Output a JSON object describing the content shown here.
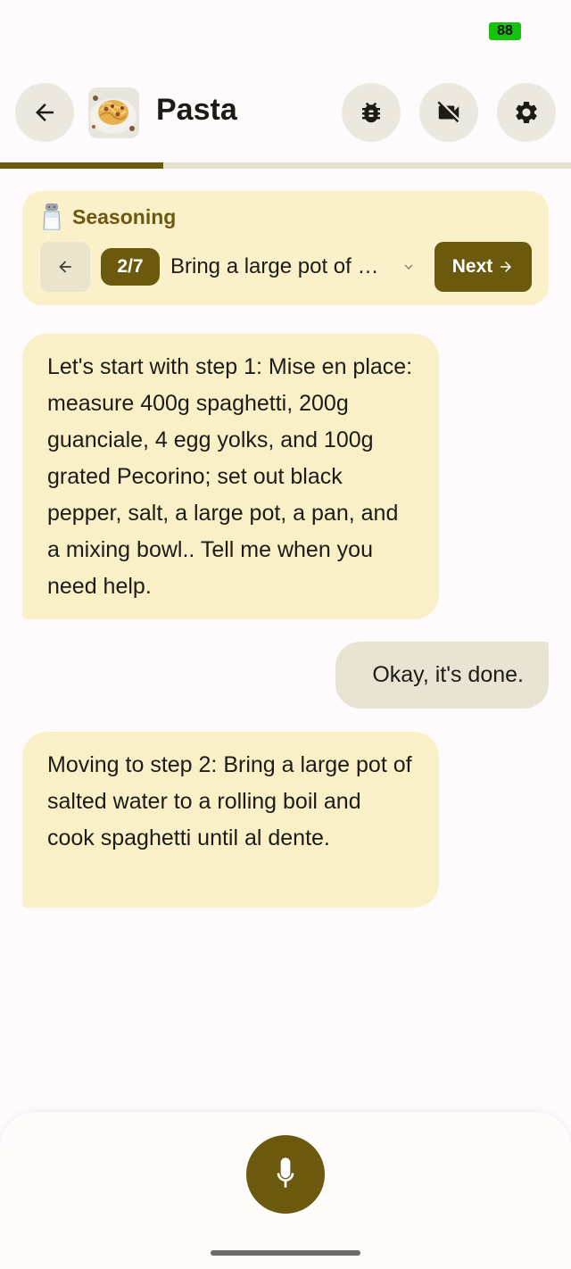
{
  "status_bar": {
    "battery_level": "88",
    "battery_color": "#17c20f"
  },
  "app_bar": {
    "title": "Pasta",
    "icons": [
      "arrow-back-icon",
      "bug-icon",
      "videocam-off-icon",
      "settings-icon"
    ]
  },
  "progress": {
    "fraction": 0.2857,
    "color": "#6b5a0d"
  },
  "step_card": {
    "section_icon": "salt-shaker-icon",
    "section_title": "Seasoning",
    "step_badge": "2/7",
    "step_text": "Bring a large pot of salted water to a rolling boil and cook spaghetti until al dente.",
    "next_label": "Next"
  },
  "messages": [
    {
      "role": "assistant",
      "text": "Let's start with step 1: Mise en place: measure 400g spaghetti, 200g guanciale, 4 egg yolks, and 100g grated Pecorino; set out black pepper, salt, a large pot, a pan, and a mixing bowl.. Tell me when you need help."
    },
    {
      "role": "user",
      "text": "Okay, it's done."
    },
    {
      "role": "assistant",
      "text": "Moving to step 2: Bring a large pot of salted water to a rolling boil and cook spaghetti until al dente."
    }
  ],
  "colors": {
    "accent": "#6b5a0d",
    "assistant_bubble": "#faf0c8",
    "user_bubble": "#e8e3d2",
    "step_card_bg": "#faf1cb"
  }
}
